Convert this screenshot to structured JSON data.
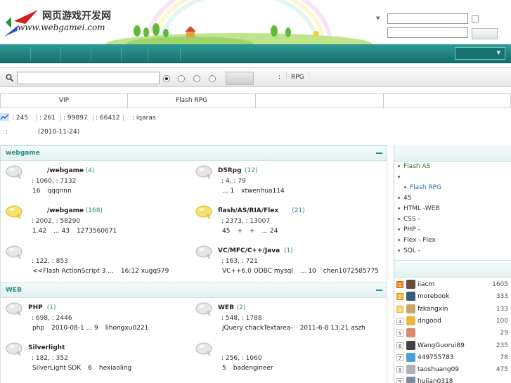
{
  "header": {
    "logo_title": "网页游戏开发网",
    "logo_url": "www.webgamei.com"
  },
  "search": {
    "filter_label": "RPG",
    "prefix": ":"
  },
  "tabs": [
    {
      "label": "VIP"
    },
    {
      "label": "Flash RPG"
    },
    {
      "label": ""
    },
    {
      "label": ""
    }
  ],
  "stats": {
    "items": [
      ": 245",
      ": 261",
      ": 99897",
      ": 66412",
      ": iqaras"
    ]
  },
  "date": {
    "prefix": ":",
    "value": "(2010-11-24)"
  },
  "sections": [
    {
      "title": "webgame",
      "forums": [
        {
          "name": "/webgame",
          "today": "(4)",
          "stats": ": 1060, : 7132",
          "last": [
            "16",
            "qqqnnn"
          ],
          "highlight": false
        },
        {
          "name": "D5Rpg",
          "today": "(12)",
          "stats": ": 4, : 79",
          "last": [
            "... 1",
            "xtwenhua114"
          ],
          "highlight": false
        },
        {
          "name": "/webgame",
          "today": "(168)",
          "stats": ": 2002, : 58290",
          "last": [
            "1.42",
            "... 43",
            "1273560671"
          ],
          "highlight": true
        },
        {
          "name": "flash/AS/RIA/Flex",
          "today": "(21)",
          "stats": ": 2373, : 13007",
          "last": [
            "45",
            "+",
            "+",
            "... 24"
          ],
          "highlight": true
        },
        {
          "name": "",
          "today": "",
          "stats": ": 122, : 853",
          "last": [
            "<<Flash ActionScript 3 ...",
            "16:12 xugq979"
          ],
          "highlight": false
        },
        {
          "name": "VC/MFC/C++/Java",
          "today": "(1)",
          "stats": ": 163, : 721",
          "last": [
            "VC++6.0 ODBC mysql",
            "... 10",
            "chen1072585775"
          ],
          "highlight": false
        }
      ]
    },
    {
      "title": "WEB",
      "forums": [
        {
          "name": "PHP",
          "today": "(1)",
          "stats": ": 698, : 2446",
          "last": [
            "php",
            "2010-08-1 ... 9",
            "lihongxu0221"
          ],
          "highlight": false
        },
        {
          "name": "WEB",
          "today": "(2)",
          "stats": ": 548, : 1788",
          "last": [
            "jQuery chackTextarea-",
            "2011-6-8 13:21 aszh"
          ],
          "highlight": false
        },
        {
          "name": "Silverlight",
          "today": "",
          "stats": ": 182, : 352",
          "last": [
            "SilverLight SDK",
            "6",
            "hexiaoling"
          ],
          "highlight": false
        },
        {
          "name": "",
          "today": "",
          "stats": ": 256, : 1060",
          "last": [
            "5",
            "badengineer"
          ],
          "highlight": false
        }
      ]
    }
  ],
  "sidebar": {
    "links": [
      {
        "label": "Flash AS",
        "color": "#1a7a1a"
      },
      {
        "label": "",
        "color": "#333333"
      },
      {
        "label": "Flash RPG",
        "color": "#2a6db5"
      },
      {
        "label": "45",
        "color": "#333333"
      },
      {
        "label": "HTML -WEB",
        "color": "#333333"
      },
      {
        "label": "CSS -",
        "color": "#333333"
      },
      {
        "label": "PHP -",
        "color": "#333333"
      },
      {
        "label": "Flex - Flex",
        "color": "#333333"
      },
      {
        "label": "SQL -",
        "color": "#333333"
      }
    ],
    "ranking": [
      {
        "rank": "1",
        "name": "iiacm",
        "score": "1605",
        "avatar": "#6b4c3b"
      },
      {
        "rank": "2",
        "name": "morebook",
        "score": "333",
        "avatar": "#3b5b7a"
      },
      {
        "rank": "3",
        "name": "fzkangxin",
        "score": "133",
        "avatar": "#c9a46b"
      },
      {
        "rank": "4",
        "name": "dngood",
        "score": "100",
        "avatar": "#e8b840"
      },
      {
        "rank": "5",
        "name": "",
        "score": "29",
        "avatar": "#d88a6a"
      },
      {
        "rank": "6",
        "name": "WangGuorui89",
        "score": "235",
        "avatar": "#444444"
      },
      {
        "rank": "7",
        "name": "449755783",
        "score": "78",
        "avatar": "#4aa0d8"
      },
      {
        "rank": "8",
        "name": "taoshuang09",
        "score": "475",
        "avatar": "#b0b0b0"
      },
      {
        "rank": "9",
        "name": "huijan0318",
        "score": "",
        "avatar": "#7a8a9a"
      }
    ]
  },
  "colors": {
    "nav": "#1f8581",
    "accent": "#2a8a86"
  }
}
